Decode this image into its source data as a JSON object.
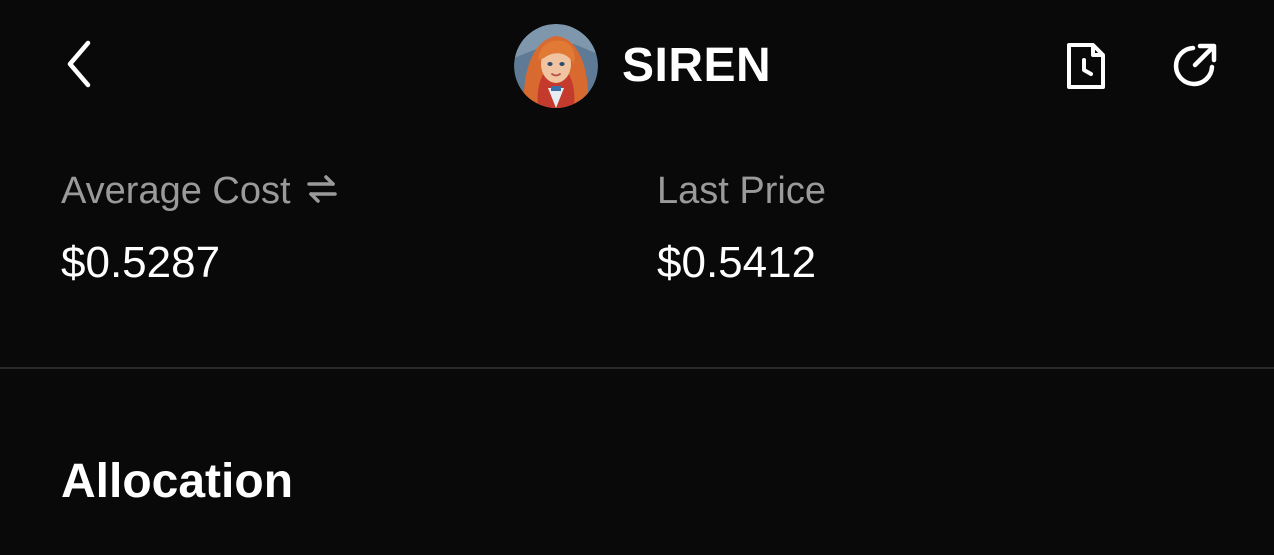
{
  "header": {
    "token_name": "SIREN",
    "icons": {
      "back": "chevron-left-icon",
      "history": "document-clock-icon",
      "share": "share-arrow-icon",
      "avatar": "siren-avatar"
    }
  },
  "stats": {
    "average_cost": {
      "label": "Average Cost",
      "value": "$0.5287",
      "toggle_icon": "swap-arrows-icon"
    },
    "last_price": {
      "label": "Last Price",
      "value": "$0.5412"
    }
  },
  "sections": {
    "allocation_title": "Allocation"
  },
  "colors": {
    "background": "#090909",
    "text_primary": "#ffffff",
    "text_secondary": "#9a9a9a",
    "divider": "#2a2a2a"
  }
}
